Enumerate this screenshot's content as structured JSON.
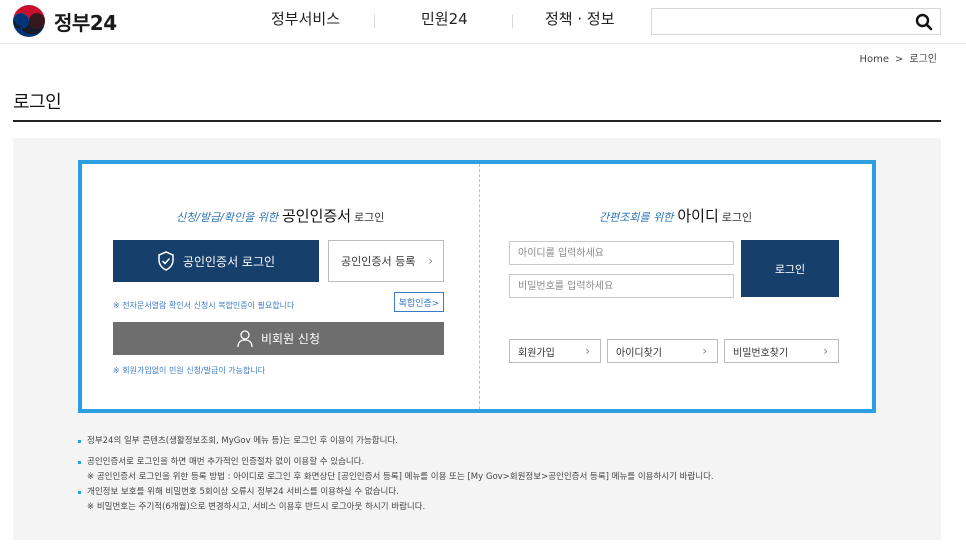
{
  "header": {
    "logo_text": "정부24",
    "nav": [
      "정부서비스",
      "민원24",
      "정책 · 정보"
    ],
    "search": {
      "value": "",
      "placeholder": ""
    }
  },
  "breadcrumb": {
    "home": "Home",
    "sep": ">",
    "current": "로그인"
  },
  "page": {
    "title": "로그인"
  },
  "cert_login": {
    "title_accent": "신청/발급/확인을 위한",
    "title_big": "공인인증서",
    "title_small": "로그인",
    "login_button": "공인인증서 로그인",
    "register_button": "공인인증서 등록",
    "note": "※ 전자문서열람 확인서 신청시 복합인증이 필요합니다",
    "joint_button": "복합인증>",
    "guest_button": "비회원 신청",
    "guest_note": "※ 회원가입없이 민원 신청/발급이 가능합니다"
  },
  "id_login": {
    "title_accent": "간편조회를 위한",
    "title_big": "아이디",
    "title_small": "로그인",
    "id_placeholder": "아이디를 입력하세요",
    "pw_placeholder": "비밀번호를 입력하세요",
    "login_button": "로그인",
    "links": [
      "회원가입",
      "아이디찾기",
      "비밀번호찾기"
    ]
  },
  "notes": [
    "정부24의 일부 콘텐츠(생활정보조회, MyGov 메뉴 등)는 로그인 후 이용이 가능합니다.",
    "공인인증서로 로그인을 하면 매번 추가적인 인증절차 없이 이용할 수 있습니다.",
    "※ 공인인증서 로그인을 위한 등록 방법 : 아이디로 로그인 후 화면상단 [공인인증서 등록] 메뉴를 이용 또는 [My Gov>회원정보>공인인증서 등록] 메뉴를 이용하시기 바랍니다.",
    "개인정보 보호를 위해 비밀번호 5회이상 오류시 정부24 서비스를 이용하실 수 없습니다.",
    "※ 비밀번호는 주기적(6개월)으로 변경하시고, 서비스 이용후 반드시 로그아웃 하시기 바랍니다."
  ],
  "colors": {
    "navy": "#163f6b",
    "panel_border": "#2b9fe0",
    "note_blue": "#3a7bc8",
    "guest_grey": "#6e6e6e"
  },
  "icons": [
    "gov-logo-icon",
    "search-icon",
    "shield-check-icon",
    "person-icon",
    "chevron-right-icon"
  ]
}
